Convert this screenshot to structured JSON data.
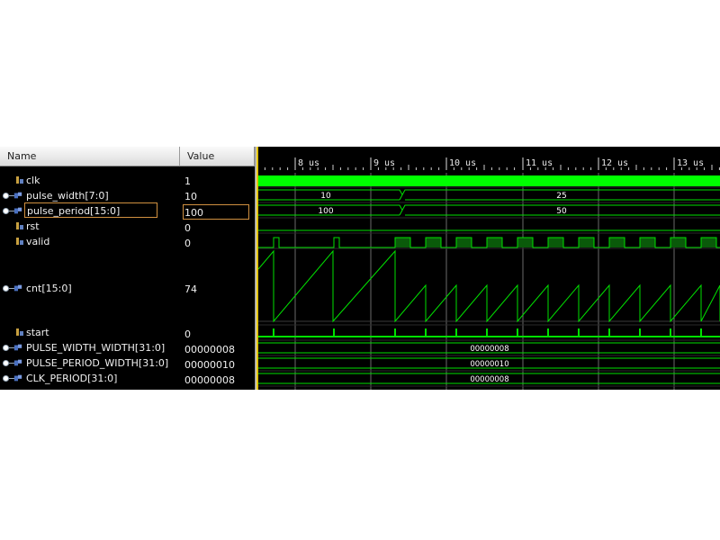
{
  "columns": {
    "name": "Name",
    "value": "Value"
  },
  "timeline": {
    "labels": [
      "8 us",
      "9 us",
      "10 us",
      "11 us",
      "12 us",
      "13 us"
    ]
  },
  "signals": [
    {
      "name": "clk",
      "value": "1",
      "kind": "bit",
      "expandable": false
    },
    {
      "name": "pulse_width[7:0]",
      "value": "10",
      "kind": "bus",
      "expandable": true,
      "segments": [
        "10",
        "25"
      ]
    },
    {
      "name": "pulse_period[15:0]",
      "value": "100",
      "kind": "bus",
      "expandable": true,
      "selected": true,
      "segments": [
        "100",
        "50"
      ]
    },
    {
      "name": "rst",
      "value": "0",
      "kind": "bit",
      "expandable": false
    },
    {
      "name": "valid",
      "value": "0",
      "kind": "bit",
      "expandable": false
    },
    {
      "name": "cnt[15:0]",
      "value": "74",
      "kind": "bus",
      "expandable": true
    },
    {
      "name": "start",
      "value": "0",
      "kind": "bit",
      "expandable": false
    },
    {
      "name": "PULSE_WIDTH_WIDTH[31:0]",
      "value": "00000008",
      "kind": "bus",
      "expandable": true,
      "segments": [
        "00000008"
      ]
    },
    {
      "name": "PULSE_PERIOD_WIDTH[31:0]",
      "value": "00000010",
      "kind": "bus",
      "expandable": true,
      "segments": [
        "00000010"
      ]
    },
    {
      "name": "CLK_PERIOD[31:0]",
      "value": "00000008",
      "kind": "bus",
      "expandable": true,
      "segments": [
        "00000008"
      ]
    }
  ],
  "colors": {
    "wave": "#00e000",
    "wave_bright": "#00ff00",
    "grid": "#8a8a8a",
    "background": "#000000",
    "selection": "#d09040"
  }
}
